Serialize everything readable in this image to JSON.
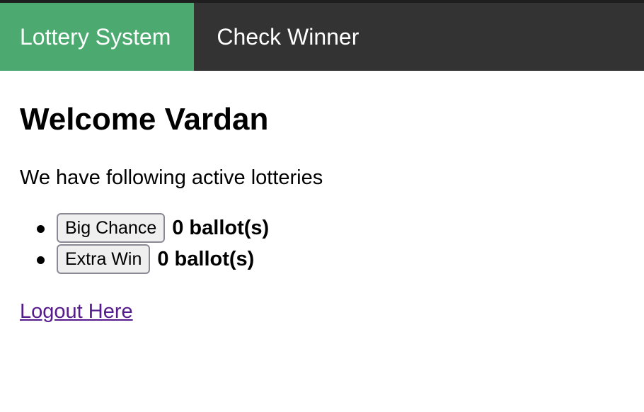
{
  "nav": {
    "brand_label": "Lottery System",
    "check_winner_label": "Check Winner"
  },
  "main": {
    "welcome_title": "Welcome Vardan",
    "intro_text": "We have following active lotteries",
    "lotteries": [
      {
        "button_label": "Big Chance",
        "ballots": "0 ballot(s)"
      },
      {
        "button_label": "Extra Win",
        "ballots": "0 ballot(s)"
      }
    ],
    "logout_label": "Logout Here"
  },
  "colors": {
    "nav_background": "#333333",
    "nav_active": "#4caa71",
    "link_visited": "#551a8b"
  }
}
